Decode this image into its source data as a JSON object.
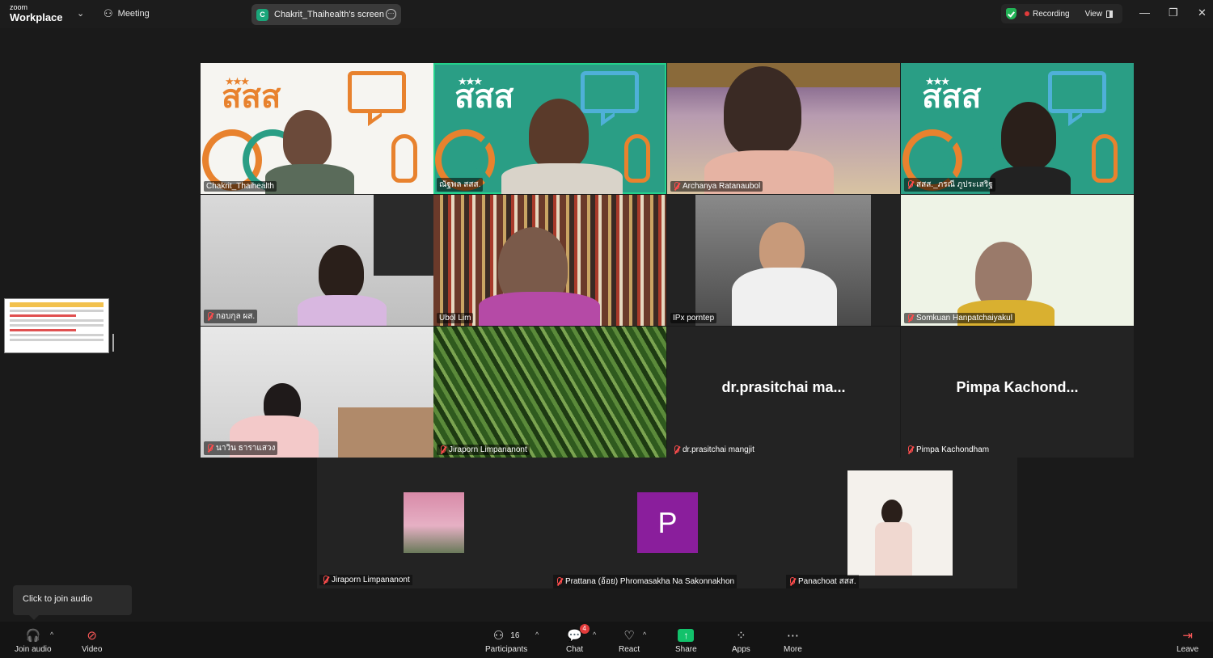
{
  "app": {
    "logo_top": "zoom",
    "logo_bottom": "Workplace",
    "meeting_label": "Meeting"
  },
  "share_pill": {
    "initial": "C",
    "label": "Chakrit_Thaihealth's screen"
  },
  "status": {
    "recording": "Recording",
    "view": "View"
  },
  "tiles": [
    {
      "name": "Chakrit_Thaihealth",
      "muted": false
    },
    {
      "name": "ณัฐพล  สสส.",
      "muted": false,
      "active": true
    },
    {
      "name": "Archanya Ratanaubol",
      "muted": true
    },
    {
      "name": "สสส._ภรณี ภูประเสริฐ",
      "muted": true
    },
    {
      "name": "กอบกุล ผส.",
      "muted": true
    },
    {
      "name": "Ubol Lim",
      "muted": false
    },
    {
      "name": "IPx porntep",
      "muted": false
    },
    {
      "name": "Somkuan Hanpatchaiyakul",
      "muted": true
    },
    {
      "name": "นาวิน ธาราแสวง",
      "muted": true
    },
    {
      "name": "Jiraporn Limpananont",
      "muted": true
    },
    {
      "name": "dr.prasitchai mangjit",
      "display": "dr.prasitchai  ma...",
      "muted": true
    },
    {
      "name": "Pimpa Kachondham",
      "display": "Pimpa  Kachond...",
      "muted": true
    }
  ],
  "tile_logo": {
    "text": "สสส"
  },
  "bottom_row": [
    {
      "name": "Jiraporn Limpananont"
    },
    {
      "name": "Prattana (อ้อย) Phromasakha Na Sakonnakhon",
      "initial": "P"
    },
    {
      "name": "Panachoat สสส."
    }
  ],
  "tooltip": "Click to join audio",
  "toolbar": {
    "join_audio": "Join audio",
    "video": "Video",
    "participants": "Participants",
    "participants_count": "16",
    "chat": "Chat",
    "chat_badge": "4",
    "react": "React",
    "share": "Share",
    "apps": "Apps",
    "more": "More",
    "leave": "Leave"
  },
  "colors": {
    "accent_green": "#23d18b",
    "record_red": "#e03b3b",
    "thaihealth_orange": "#e8822e",
    "thaihealth_teal": "#2a9e85",
    "avatar_purple": "#8a1e9c"
  }
}
